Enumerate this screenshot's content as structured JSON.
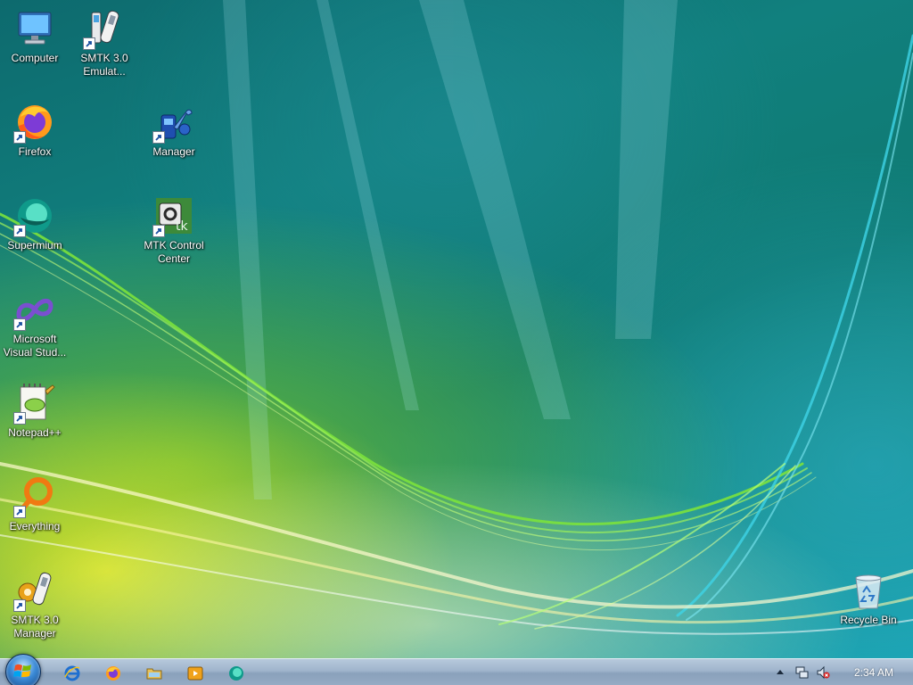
{
  "desktop": {
    "icons": [
      {
        "label": "Computer",
        "icon": "computer-icon"
      },
      {
        "label": "SMTK 3.0\nEmulat...",
        "icon": "phone-emulator-icon"
      },
      {
        "label": "Firefox",
        "icon": "firefox-icon"
      },
      {
        "label": "Manager",
        "icon": "manager-tools-icon"
      },
      {
        "label": "Supermium",
        "icon": "supermium-icon"
      },
      {
        "label": "MTK Control\nCenter",
        "icon": "mtk-icon"
      },
      {
        "label": "Microsoft\nVisual Stud...",
        "icon": "visual-studio-icon"
      },
      {
        "label": "Notepad++",
        "icon": "notepadpp-icon"
      },
      {
        "label": "Everything",
        "icon": "everything-search-icon"
      },
      {
        "label": "SMTK 3.0\nManager",
        "icon": "phone-manager-icon"
      },
      {
        "label": "Recycle Bin",
        "icon": "recycle-bin-icon"
      }
    ]
  },
  "taskbar": {
    "start": "start-orb-icon",
    "quick_launch": [
      "internet-explorer-icon",
      "firefox-icon",
      "explorer-folder-icon",
      "media-player-icon",
      "supermium-icon"
    ],
    "tray": [
      "show-hidden-icons-arrow",
      "network-icon",
      "volume-muted-icon"
    ],
    "clock": "2:34 AM"
  },
  "colors": {
    "taskbar": "#9fb4cc",
    "wallpaper_teal": "#11807e",
    "wallpaper_yellow": "#dce628"
  }
}
